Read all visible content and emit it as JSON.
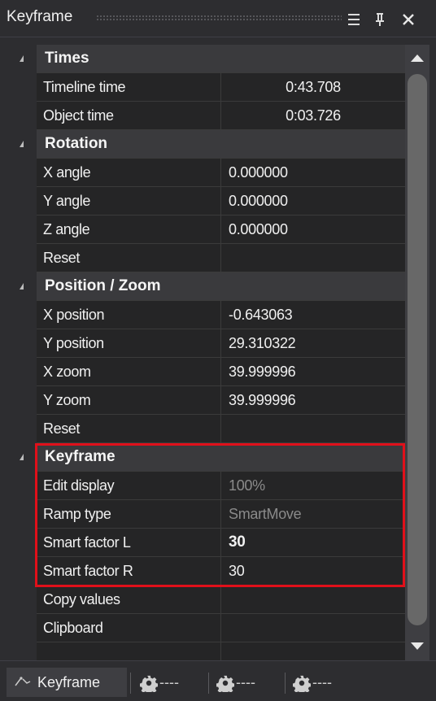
{
  "window": {
    "title": "Keyframe"
  },
  "categories": {
    "times": "Times",
    "rotation": "Rotation",
    "position_zoom": "Position / Zoom",
    "keyframe": "Keyframe"
  },
  "rows": {
    "timeline_time": {
      "label": "Timeline time",
      "value": "0:43.708"
    },
    "object_time": {
      "label": "Object time",
      "value": "0:03.726"
    },
    "x_angle": {
      "label": "X angle",
      "value": "0.000000"
    },
    "y_angle": {
      "label": "Y angle",
      "value": "0.000000"
    },
    "z_angle": {
      "label": "Z angle",
      "value": "0.000000"
    },
    "rot_reset": {
      "label": "Reset",
      "value": ""
    },
    "x_position": {
      "label": "X position",
      "value": "-0.643063"
    },
    "y_position": {
      "label": "Y position",
      "value": "29.310322"
    },
    "x_zoom": {
      "label": "X zoom",
      "value": "39.999996"
    },
    "y_zoom": {
      "label": "Y zoom",
      "value": "39.999996"
    },
    "pos_reset": {
      "label": "Reset",
      "value": ""
    },
    "edit_display": {
      "label": "Edit display",
      "value": "100%"
    },
    "ramp_type": {
      "label": "Ramp type",
      "value": "SmartMove"
    },
    "smart_factor_l": {
      "label": "Smart factor L",
      "value": "30"
    },
    "smart_factor_r": {
      "label": "Smart factor R",
      "value": "30"
    },
    "copy_values": {
      "label": "Copy values",
      "value": ""
    },
    "clipboard": {
      "label": "Clipboard",
      "value": ""
    }
  },
  "tabs": {
    "active": "Keyframe",
    "gear1": "----",
    "gear2": "----",
    "gear3": "----"
  },
  "colors": {
    "highlight_border": "#e0101a",
    "category_bg": "#3a3a3d",
    "panel_bg": "#252526"
  }
}
